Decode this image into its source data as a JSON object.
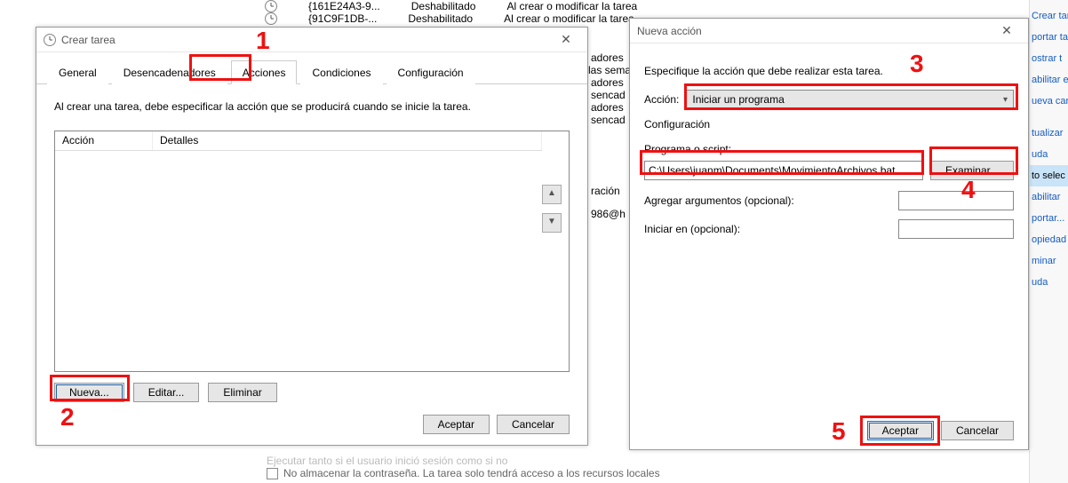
{
  "bg_tasks": [
    {
      "id": "{161E24A3-9...",
      "status": "Deshabilitado",
      "trigger": "Al crear o modificar la tarea"
    },
    {
      "id": "{91C9F1DB-...",
      "status": "Deshabilitado",
      "trigger": "Al crear o modificar la tarea"
    }
  ],
  "bg_fragments": {
    "f1": "adores",
    "f2": "las sema",
    "f3": "adores",
    "f4": "sencad",
    "f5": "adores",
    "f6": "sencad",
    "f7": "ración",
    "f8": "986@h"
  },
  "dialog_left": {
    "title": "Crear tarea",
    "tabs": {
      "general": "General",
      "triggers": "Desencadenadores",
      "actions": "Acciones",
      "conditions": "Condiciones",
      "settings": "Configuración"
    },
    "hint": "Al crear una tarea, debe especificar la acción que se producirá cuando se inicie la tarea.",
    "columns": {
      "action": "Acción",
      "details": "Detalles"
    },
    "buttons": {
      "new": "Nueva...",
      "edit": "Editar...",
      "delete": "Eliminar"
    },
    "dialog_buttons": {
      "ok": "Aceptar",
      "cancel": "Cancelar"
    }
  },
  "dialog_right": {
    "title": "Nueva acción",
    "hint": "Especifique la acción que debe realizar esta tarea.",
    "action_label": "Acción:",
    "action_selected": "Iniciar un programa",
    "config_label": "Configuración",
    "program_label": "Programa o script:",
    "program_value": "C:\\Users\\juanm\\Documents\\MovimientoArchivos.bat",
    "browse": "Examinar...",
    "args_label": "Agregar argumentos (opcional):",
    "startin_label": "Iniciar en (opcional):",
    "dialog_buttons": {
      "ok": "Aceptar",
      "cancel": "Cancelar"
    }
  },
  "side_panel": {
    "items": [
      "Crear tarea",
      "portar ta",
      "ostrar t",
      "abilitar e",
      "ueva carp",
      "",
      "tualizar",
      "uda",
      "to selec",
      "abilitar",
      "portar...",
      "opiedad",
      "minar",
      "uda"
    ]
  },
  "bottom": {
    "line1_partial": "Ejecutar tanto si el usuario inició sesión como si no",
    "line2": "No almacenar la contraseña. La tarea solo tendrá acceso a los recursos locales"
  },
  "callouts": {
    "n1": "1",
    "n2": "2",
    "n3": "3",
    "n4": "4",
    "n5": "5"
  }
}
